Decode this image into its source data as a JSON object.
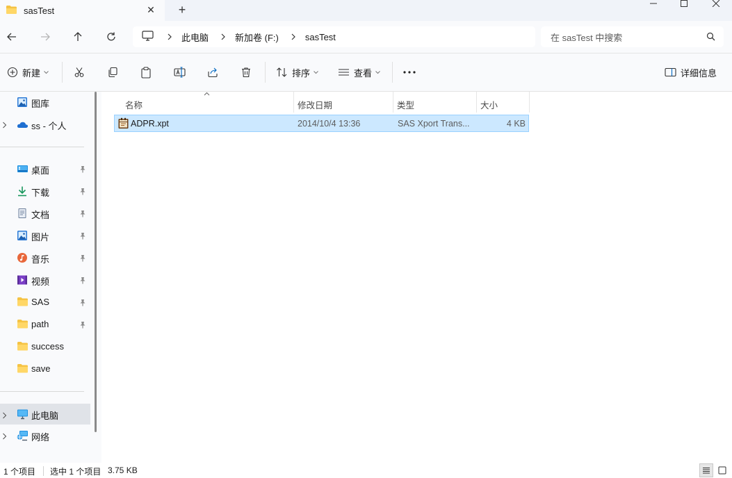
{
  "window": {
    "tab_title": "sasTest",
    "tab_close": "✕",
    "new_tab": "+"
  },
  "breadcrumb": [
    "此电脑",
    "新加卷 (F:)",
    "sasTest"
  ],
  "search": {
    "placeholder": "在 sasTest 中搜索"
  },
  "toolbar": {
    "new_label": "新建",
    "sort_label": "排序",
    "view_label": "查看",
    "more_label": "···",
    "details_label": "详细信息"
  },
  "sidebar": {
    "top": [
      {
        "label": "图库",
        "icon": "gallery-icon"
      },
      {
        "label": "ss - 个人",
        "icon": "onedrive-icon"
      }
    ],
    "quick_access": [
      {
        "label": "桌面",
        "icon": "desktop-icon",
        "pinned": true
      },
      {
        "label": "下载",
        "icon": "download-icon",
        "pinned": true
      },
      {
        "label": "文档",
        "icon": "documents-icon",
        "pinned": true
      },
      {
        "label": "图片",
        "icon": "pictures-icon",
        "pinned": true
      },
      {
        "label": "音乐",
        "icon": "music-icon",
        "pinned": true
      },
      {
        "label": "视频",
        "icon": "videos-icon",
        "pinned": true
      },
      {
        "label": "SAS",
        "icon": "folder-icon",
        "pinned": true
      },
      {
        "label": "path",
        "icon": "folder-icon",
        "pinned": true
      },
      {
        "label": "success",
        "icon": "folder-icon",
        "pinned": false
      },
      {
        "label": "save",
        "icon": "folder-icon",
        "pinned": false
      }
    ],
    "bottom": [
      {
        "label": "此电脑",
        "icon": "this-pc-icon",
        "selected": true
      },
      {
        "label": "网络",
        "icon": "network-icon",
        "selected": false
      }
    ]
  },
  "columns": {
    "name": "名称",
    "modified": "修改日期",
    "type": "类型",
    "size": "大小"
  },
  "files": [
    {
      "name": "ADPR.xpt",
      "modified": "2014/10/4 13:36",
      "type": "SAS Xport Trans...",
      "size": "4 KB",
      "selected": true
    }
  ],
  "status": {
    "count": "1 个项目",
    "selection": "选中 1 个项目",
    "size": "3.75 KB"
  },
  "colors": {
    "selection_fill": "#cce8ff",
    "selection_border": "#99d1ff",
    "folder": "#f5c344",
    "accent": "#0067c0"
  }
}
